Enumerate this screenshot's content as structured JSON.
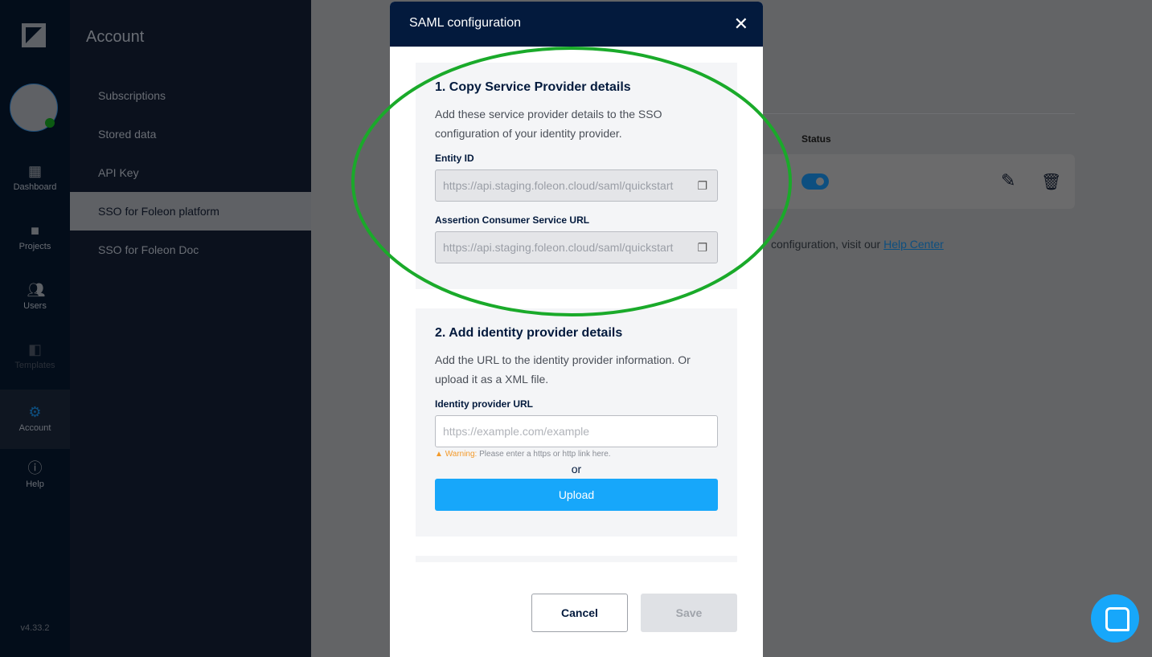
{
  "rail": {
    "items": [
      {
        "label": "Dashboard",
        "icon": "dashboard-icon"
      },
      {
        "label": "Projects",
        "icon": "folder-icon"
      },
      {
        "label": "Users",
        "icon": "users-icon"
      },
      {
        "label": "Templates",
        "icon": "templates-icon"
      },
      {
        "label": "Account",
        "icon": "gear-icon"
      },
      {
        "label": "Help",
        "icon": "info-icon"
      }
    ],
    "version": "v4.33.2"
  },
  "panel": {
    "title": "Account",
    "items": [
      "Subscriptions",
      "Stored data",
      "API Key",
      "SSO for Foleon platform",
      "SSO for Foleon Doc"
    ],
    "active": "SSO for Foleon platform"
  },
  "main": {
    "status_header": "Status",
    "status_enabled": true,
    "help_prefix": "configuration, visit our ",
    "help_link": "Help Center"
  },
  "modal": {
    "title": "SAML configuration",
    "section1": {
      "title": "1. Copy Service Provider details",
      "desc": "Add these service provider details to the SSO configuration of your identity provider.",
      "entity_label": "Entity ID",
      "entity_value": "https://api.staging.foleon.cloud/saml/quickstart",
      "acs_label": "Assertion Consumer Service URL",
      "acs_value": "https://api.staging.foleon.cloud/saml/quickstart"
    },
    "section2": {
      "title": "2. Add identity provider details",
      "desc": "Add the URL to the identity provider information. Or upload it as a XML file.",
      "idp_label": "Identity provider URL",
      "idp_placeholder": "https://example.com/example",
      "warning_label": "Warning:",
      "warning_text": " Please enter a https or http link here.",
      "or": "or",
      "upload": "Upload"
    },
    "cancel": "Cancel",
    "save": "Save"
  },
  "colors": {
    "accent": "#17a7fa",
    "header": "#031a3d",
    "annotation": "#1aaa2a",
    "warning": "#f39a2a"
  }
}
